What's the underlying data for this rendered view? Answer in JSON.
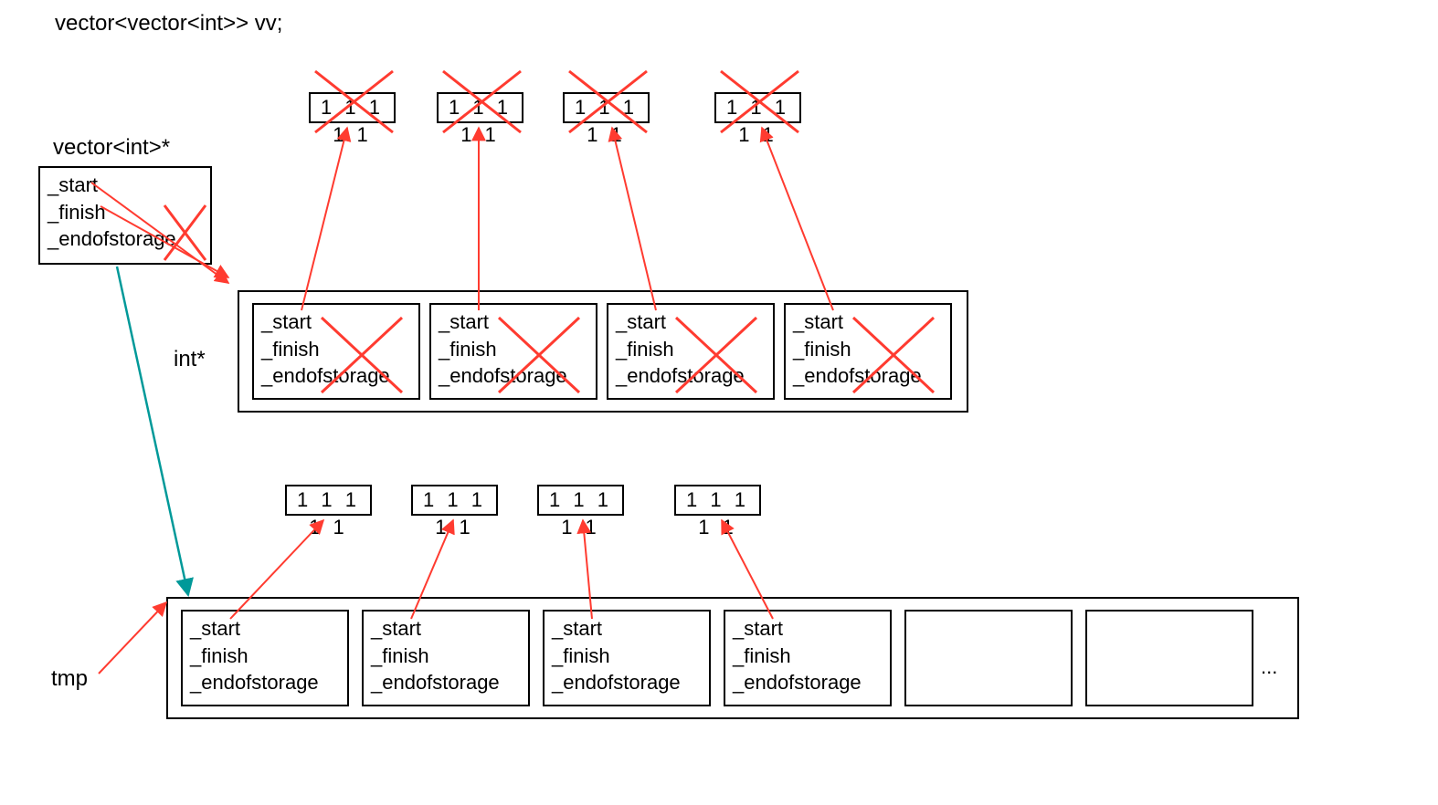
{
  "title": "vector<vector<int>> vv;",
  "labels": {
    "vectorIntPtr": "vector<int>*",
    "intPtr": "int*",
    "tmp": "tmp",
    "ellipsis": "..."
  },
  "members": {
    "start": "_start",
    "finish": "_finish",
    "endofstorage": "_endofstorage"
  },
  "dataCells": {
    "ones": "1 1 1 1 1"
  },
  "topSmallBoxes": [
    "1 1 1 1 1",
    "1 1 1 1 1",
    "1 1 1 1 1",
    "1 1 1 1 1"
  ],
  "bottomSmallBoxes": [
    "1 1 1 1 1",
    "1 1 1 1 1",
    "1 1 1 1 1",
    "1 1 1 1 1"
  ],
  "innerVectorsTop": 4,
  "innerVectorsBottom": 4,
  "emptySlotsBottom": 2,
  "colors": {
    "red": "#ff3b30",
    "teal": "#009999"
  }
}
